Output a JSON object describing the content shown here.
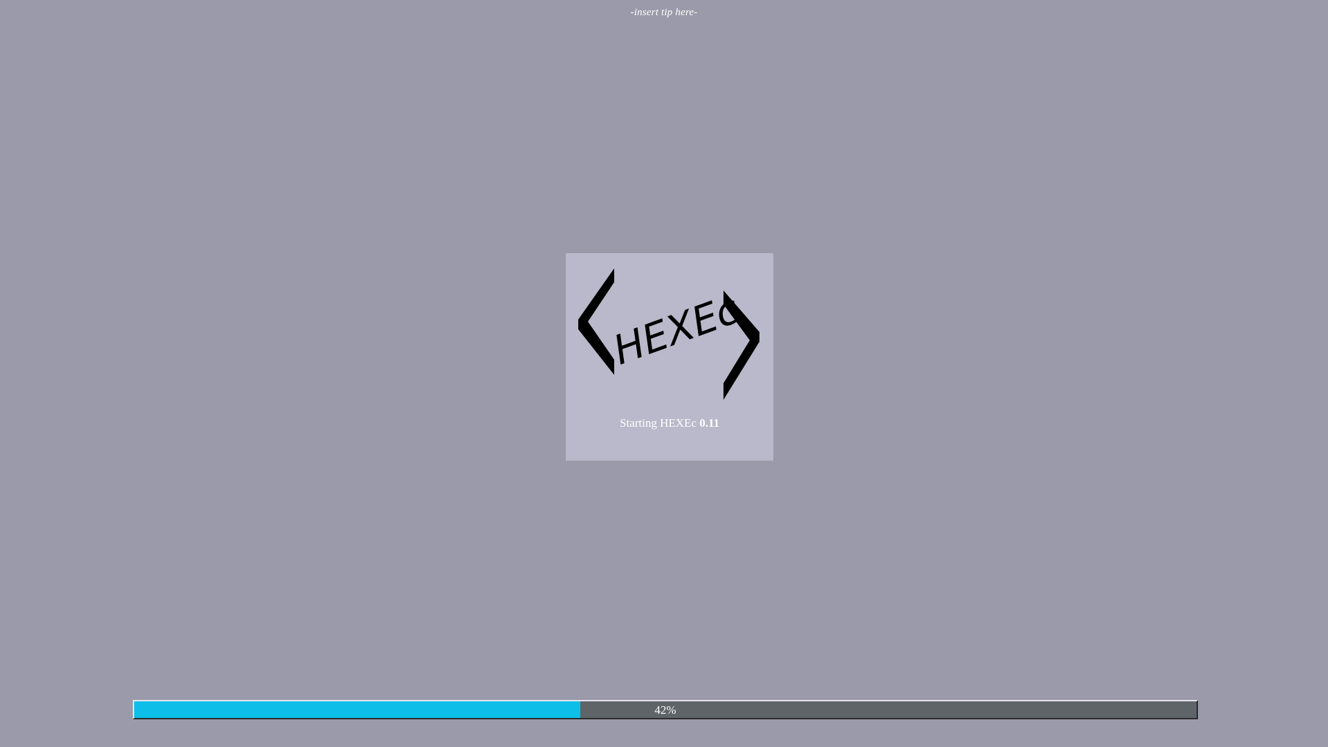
{
  "tip": "-insert tip here-",
  "splash": {
    "status_prefix": "Starting HEXEc",
    "version": "0.11",
    "logo_text": "HEXEc"
  },
  "progress": {
    "value": 0.42,
    "label": "42%",
    "fill_color": "#0dbfe8",
    "track_color": "#5e6468"
  },
  "colors": {
    "background": "#9b9aaa",
    "splash_background": "#b9b9cb"
  }
}
